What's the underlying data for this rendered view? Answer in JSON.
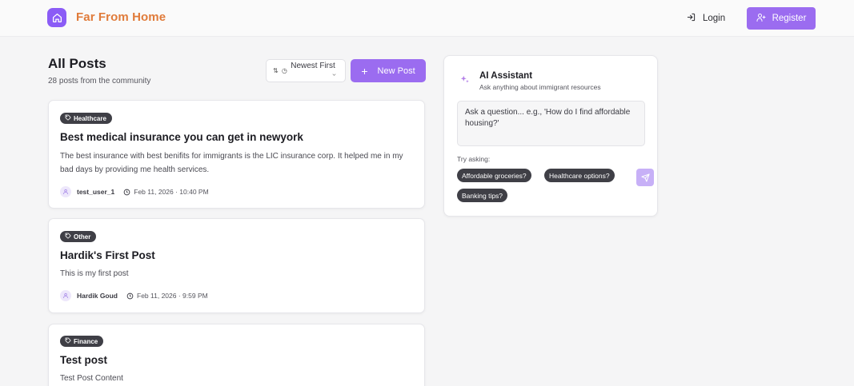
{
  "header": {
    "brand": "Far From Home",
    "login_label": "Login",
    "register_label": "Register",
    "brand_color": "#e07b3a",
    "accent_color": "#9b6cf0"
  },
  "feed": {
    "title": "All Posts",
    "subtitle": "28 posts from the community",
    "sort_selected": "Newest First",
    "new_post_label": "New Post"
  },
  "posts": [
    {
      "category": "Healthcare",
      "title": "Best medical insurance you can get in newyork",
      "body": "The best insurance with best benifits for immigrants is the LIC insurance corp. It helped me in my bad days by providing me health services.",
      "author": "test_user_1",
      "date": "Feb 11, 2026 · 10:40 PM"
    },
    {
      "category": "Other",
      "title": "Hardik's First Post",
      "body": "This is my first post",
      "author": "Hardik Goud",
      "date": "Feb 11, 2026 · 9:59 PM"
    },
    {
      "category": "Finance",
      "title": "Test post",
      "body": "Test Post Content"
    }
  ],
  "assistant": {
    "title": "AI Assistant",
    "subtitle": "Ask anything about immigrant resources",
    "placeholder": "Ask a question... e.g., 'How do I find affordable housing?'",
    "try_label": "Try asking:",
    "suggestions": [
      "Affordable groceries?",
      "Healthcare options?",
      "Banking tips?"
    ]
  }
}
